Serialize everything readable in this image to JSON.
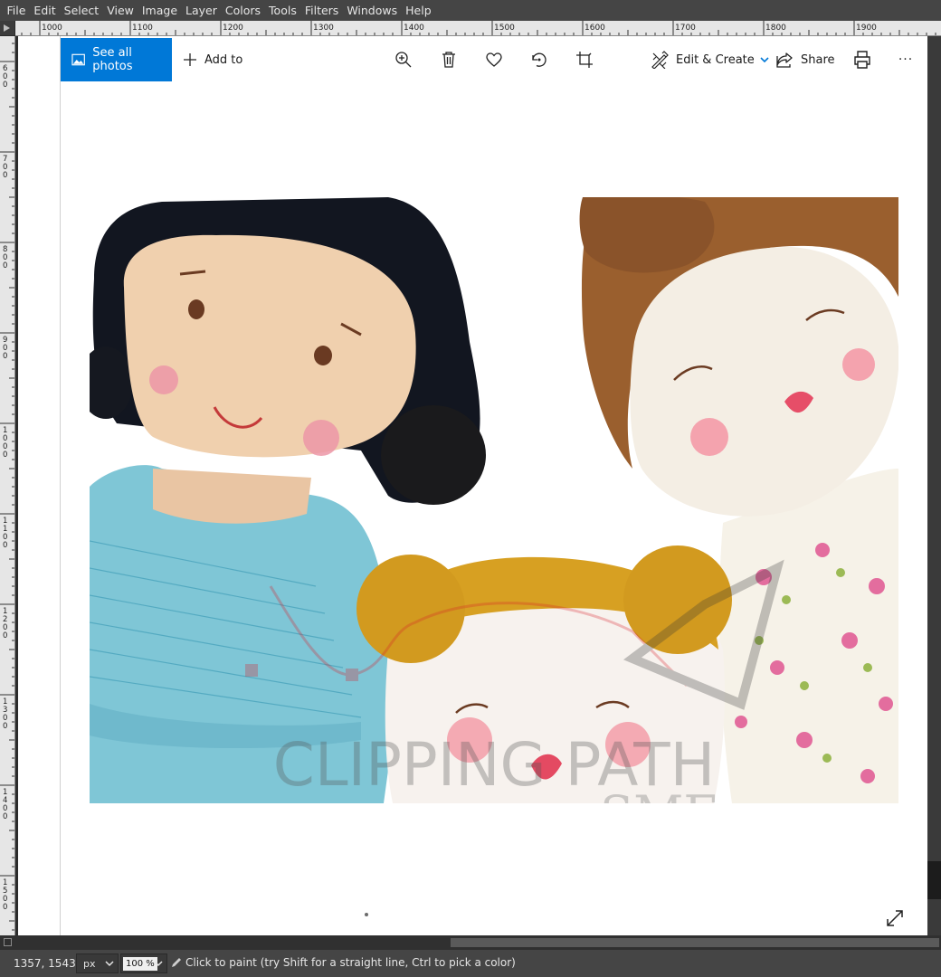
{
  "menubar": {
    "items": [
      "File",
      "Edit",
      "Select",
      "View",
      "Image",
      "Layer",
      "Colors",
      "Tools",
      "Filters",
      "Windows",
      "Help"
    ]
  },
  "rulers": {
    "horizontal_labels": [
      "1000",
      "1100",
      "1200",
      "1300",
      "1400",
      "1500",
      "1600",
      "1700",
      "1800",
      "1900"
    ],
    "vertical_labels": [
      "600",
      "700",
      "800",
      "900",
      "1000",
      "1100",
      "1200",
      "1300",
      "1400",
      "1500"
    ]
  },
  "photos_toolbar": {
    "see_all_label": "See all photos",
    "add_to_label": "Add to",
    "edit_create_label": "Edit & Create",
    "share_label": "Share",
    "more_label": "···",
    "icons": [
      "zoom-in-icon",
      "delete-icon",
      "heart-icon",
      "rotate-icon",
      "crop-icon",
      "print-icon"
    ]
  },
  "photo": {
    "watermark_line1": "CLIPPING PATH",
    "watermark_line2": "SME"
  },
  "statusbar": {
    "coords": "1357, 1543",
    "unit": "px",
    "zoom": "100 %",
    "message": "Click to paint (try Shift for a straight line, Ctrl to pick a color)"
  },
  "colors": {
    "accent": "#0078d7",
    "gimp_bg": "#454545",
    "ruler_bg": "#e6e6e6"
  }
}
